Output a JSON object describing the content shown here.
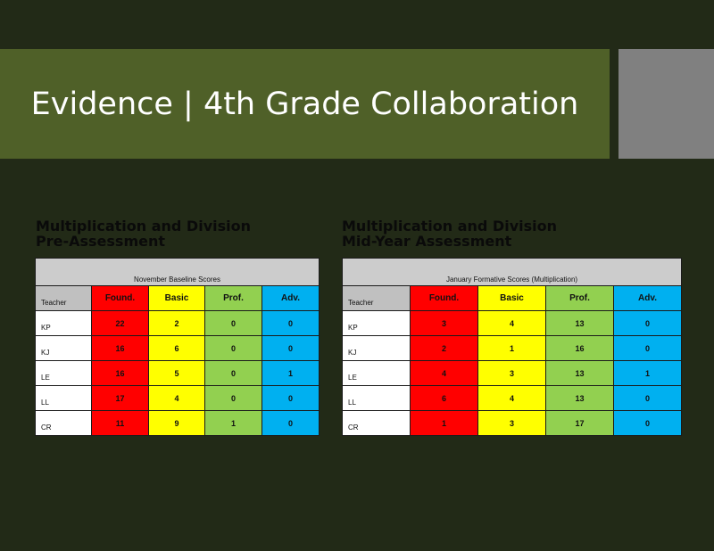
{
  "slide": {
    "title": "Evidence | 4th Grade Collaboration"
  },
  "colors": {
    "background": "#222a17",
    "title_banner": "#4f6028",
    "gray_block": "#808080",
    "foundational": "#ff0000",
    "basic": "#ffff00",
    "proficient": "#92d050",
    "advanced": "#00b0f0"
  },
  "left_panel": {
    "heading_line1": "Multiplication and Division",
    "heading_line2": "Pre-Assessment",
    "table": {
      "caption": "November  Baseline  Scores",
      "headers": [
        "Teacher",
        "Found.",
        "Basic",
        "Prof.",
        "Adv."
      ],
      "rows": [
        {
          "teacher": "KP",
          "found": "22",
          "basic": "2",
          "prof": "0",
          "adv": "0"
        },
        {
          "teacher": "KJ",
          "found": "16",
          "basic": "6",
          "prof": "0",
          "adv": "0"
        },
        {
          "teacher": "LE",
          "found": "16",
          "basic": "5",
          "prof": "0",
          "adv": "1"
        },
        {
          "teacher": "LL",
          "found": "17",
          "basic": "4",
          "prof": "0",
          "adv": "0"
        },
        {
          "teacher": "CR",
          "found": "11",
          "basic": "9",
          "prof": "1",
          "adv": "0"
        }
      ]
    }
  },
  "right_panel": {
    "heading_line1": "Multiplication and Division",
    "heading_line2": "Mid-Year Assessment",
    "table": {
      "caption": "January  Formative  Scores  (Multiplication)",
      "headers": [
        "Teacher",
        "Found.",
        "Basic",
        "Prof.",
        "Adv."
      ],
      "rows": [
        {
          "teacher": "KP",
          "found": "3",
          "basic": "4",
          "prof": "13",
          "adv": "0"
        },
        {
          "teacher": "KJ",
          "found": "2",
          "basic": "1",
          "prof": "16",
          "adv": "0"
        },
        {
          "teacher": "LE",
          "found": "4",
          "basic": "3",
          "prof": "13",
          "adv": "1"
        },
        {
          "teacher": "LL",
          "found": "6",
          "basic": "4",
          "prof": "13",
          "adv": "0"
        },
        {
          "teacher": "CR",
          "found": "1",
          "basic": "3",
          "prof": "17",
          "adv": "0"
        }
      ]
    }
  }
}
